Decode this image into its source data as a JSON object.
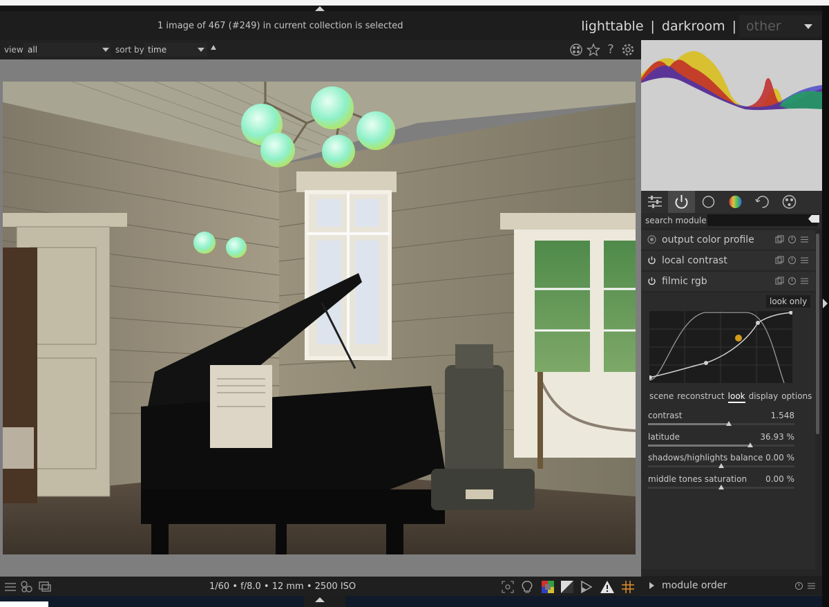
{
  "header": {
    "status": "1 image of 467 (#249) in current collection is selected",
    "views": {
      "lighttable": "lighttable",
      "sep": "|",
      "darkroom": "darkroom",
      "other": "other"
    }
  },
  "toolbar": {
    "view_label": "view",
    "view_value": "all",
    "sort_label": "sort by",
    "sort_value": "time",
    "icons": [
      "grouping-icon",
      "star-icon",
      "help-icon",
      "gear-icon"
    ]
  },
  "right_panel": {
    "tabs": [
      "presets-icon",
      "power-icon",
      "circle-icon",
      "color-icon",
      "correct-icon",
      "effects-icon"
    ],
    "search_label": "search module",
    "modules": [
      {
        "name": "output color profile",
        "state": "always-on"
      },
      {
        "name": "local contrast",
        "state": "on"
      },
      {
        "name": "filmic rgb",
        "state": "on"
      }
    ],
    "filmic": {
      "look_only": "look only",
      "subtabs": [
        "scene",
        "reconstruct",
        "look",
        "display",
        "options"
      ],
      "active_subtab": "look",
      "sliders": [
        {
          "label": "contrast",
          "value": "1.548",
          "fraction": 0.55
        },
        {
          "label": "latitude",
          "value": "36.93 %",
          "fraction": 0.7
        },
        {
          "label": "shadows/highlights balance",
          "value": "0.00 %",
          "fraction": 0.5
        },
        {
          "label": "middle tones saturation",
          "value": "0.00 %",
          "fraction": 0.5
        }
      ]
    },
    "module_order": "module order"
  },
  "bottom_bar": {
    "exif": "1/60 • f/8.0 • 12 mm • 2500 ISO"
  },
  "colors": {
    "accent_orange": "#d49a1c",
    "panel_bg": "#262626",
    "center_bg": "#7e7e7e"
  }
}
